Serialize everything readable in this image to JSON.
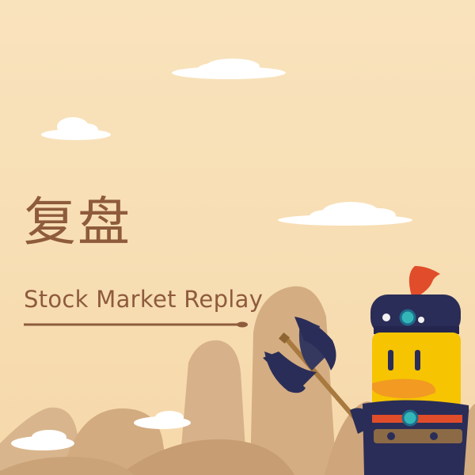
{
  "title": {
    "chinese": "复盘",
    "english": "Stock Market Replay"
  },
  "colors": {
    "background": "#f7ddb2",
    "text": "#8e5b3c",
    "mountain": "#d7b088",
    "mountain_dark": "#c49b72",
    "duck_yellow": "#f6c400",
    "duck_beak": "#f29a22",
    "helmet": "#2a2d57",
    "accent_red": "#e14d2a",
    "gem": "#33b6b8"
  },
  "icons": {
    "mascot": "duck-warrior-illustration",
    "weapon": "battle-axe-icon",
    "clouds": "cloud-icon"
  }
}
